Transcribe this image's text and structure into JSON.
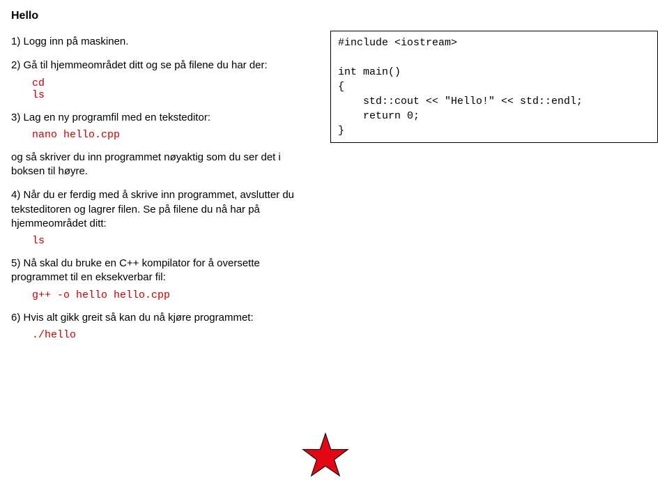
{
  "title": "Hello",
  "steps": {
    "s1": "1) Logg inn på maskinen.",
    "s2": "2) Gå til hjemmeområdet ditt og se på filene du har der:",
    "s2_cmd": "cd\nls",
    "s3": "3) Lag en ny programfil med en teksteditor:",
    "s3_cmd": "nano hello.cpp",
    "s3b": "og så skriver du inn programmet nøyaktig som du ser det i boksen til høyre.",
    "s4": "4) Når du er ferdig med å skrive inn programmet, avslutter du teksteditoren og lagrer filen. Se på filene du nå har på hjemmeområdet ditt:",
    "s4_cmd": "ls",
    "s5": "5) Nå skal du bruke en C++ kompilator for å oversette programmet til en eksekverbar fil:",
    "s5_cmd": "g++ -o hello hello.cpp",
    "s6": "6) Hvis alt gikk greit så kan du nå kjøre programmet:",
    "s6_cmd": "./hello"
  },
  "code": "#include <iostream>\n\nint main()\n{\n    std::cout << \"Hello!\" << std::endl;\n    return 0;\n}"
}
